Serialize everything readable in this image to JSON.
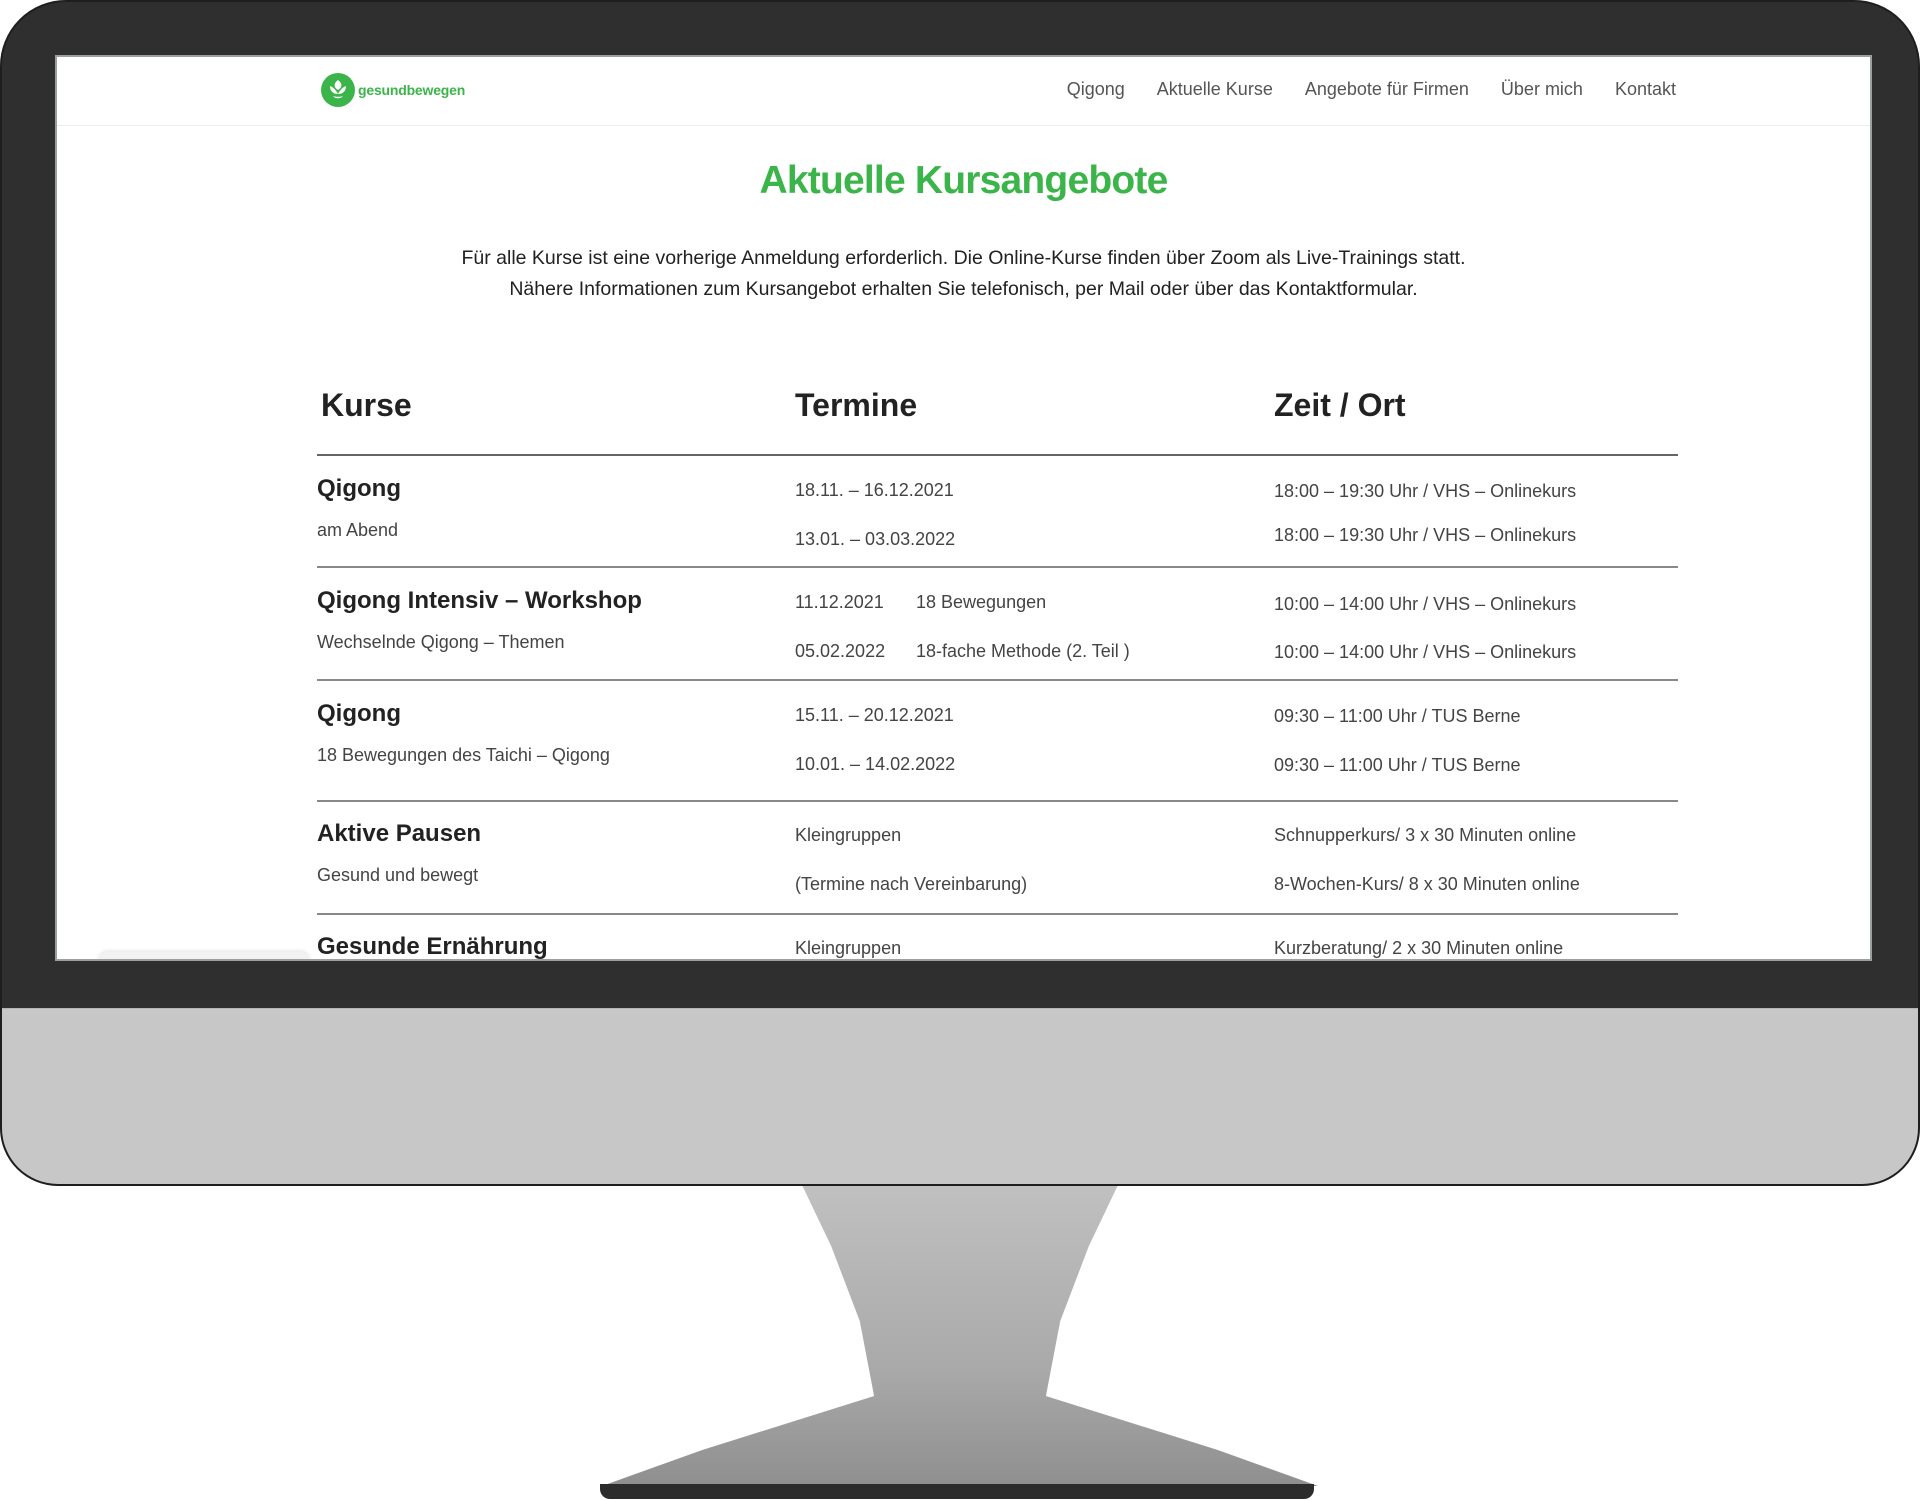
{
  "site": {
    "logo_text": "gesundbewegen",
    "nav": [
      "Qigong",
      "Aktuelle Kurse",
      "Angebote für Firmen",
      "Über mich",
      "Kontakt"
    ]
  },
  "page": {
    "title": "Aktuelle Kursangebote",
    "intro_line1": "Für alle Kurse ist eine vorherige Anmeldung erforderlich. Die Online-Kurse finden über Zoom als Live-Trainings statt.",
    "intro_line2": "Nähere Informationen zum Kursangebot erhalten Sie telefonisch, per Mail oder über das Kontaktformular."
  },
  "table": {
    "headers": [
      "Kurse",
      "Termine",
      "Zeit / Ort"
    ],
    "rows": [
      {
        "title": "Qigong",
        "subtitle": "am Abend",
        "dates": [
          "18.11. – 16.12.2021",
          "13.01. – 03.03.2022"
        ],
        "notes": [
          "",
          ""
        ],
        "times": [
          "18:00 – 19:30 Uhr / VHS – Onlinekurs",
          "18:00 – 19:30 Uhr / VHS – Onlinekurs"
        ]
      },
      {
        "title": "Qigong Intensiv – Workshop",
        "subtitle": "Wechselnde Qigong – Themen",
        "dates": [
          "11.12.2021",
          "05.02.2022"
        ],
        "notes": [
          "18 Bewegungen",
          "18-fache Methode (2. Teil )"
        ],
        "times": [
          "10:00 – 14:00 Uhr / VHS – Onlinekurs",
          "10:00 – 14:00 Uhr / VHS – Onlinekurs"
        ]
      },
      {
        "title": "Qigong",
        "subtitle": "18 Bewegungen des Taichi – Qigong",
        "dates": [
          "15.11. – 20.12.2021",
          "10.01. – 14.02.2022"
        ],
        "notes": [
          "",
          ""
        ],
        "times": [
          "09:30 – 11:00 Uhr / TUS Berne",
          "09:30 – 11:00 Uhr / TUS Berne"
        ]
      },
      {
        "title": "Aktive Pausen",
        "subtitle": "Gesund und bewegt",
        "dates": [
          "Kleingruppen",
          "(Termine nach Vereinbarung)"
        ],
        "notes": [
          "",
          ""
        ],
        "times": [
          "Schnupperkurs/ 3 x 30 Minuten online",
          "8-Wochen-Kurs/ 8 x 30 Minuten online"
        ]
      },
      {
        "title": "Gesunde Ernährung",
        "subtitle": "",
        "dates": [
          "Kleingruppen",
          ""
        ],
        "notes": [
          "",
          ""
        ],
        "times": [
          "Kurzberatung/ 2 x 30 Minuten online",
          ""
        ]
      }
    ]
  }
}
